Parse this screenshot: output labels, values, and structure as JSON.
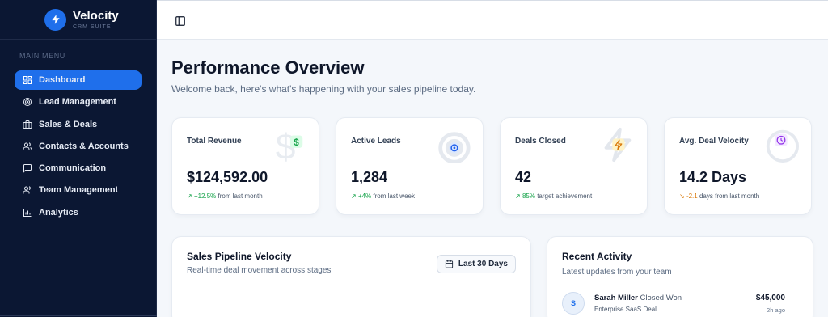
{
  "brand": {
    "name": "Velocity",
    "subtitle": "CRM SUITE"
  },
  "sidebar": {
    "menu_title": "MAIN MENU",
    "items": [
      {
        "label": "Dashboard",
        "icon": "dashboard-icon",
        "active": true
      },
      {
        "label": "Lead Management",
        "icon": "target-icon"
      },
      {
        "label": "Sales & Deals",
        "icon": "briefcase-icon"
      },
      {
        "label": "Contacts & Accounts",
        "icon": "users-icon"
      },
      {
        "label": "Communication",
        "icon": "chat-icon"
      },
      {
        "label": "Team Management",
        "icon": "team-icon"
      },
      {
        "label": "Analytics",
        "icon": "bar-chart-icon"
      }
    ]
  },
  "topbar": {
    "toggle_icon": "panel-toggle-icon"
  },
  "page": {
    "title": "Performance Overview",
    "subtitle": "Welcome back, here's what's happening with your sales pipeline today."
  },
  "stats": [
    {
      "label": "Total Revenue",
      "value": "$124,592.00",
      "delta": "+12.5%",
      "delta_text": "from last month",
      "trend": "up",
      "icon": "dollar-icon",
      "color": "#16a34a"
    },
    {
      "label": "Active Leads",
      "value": "1,284",
      "delta": "+4%",
      "delta_text": "from last week",
      "trend": "up",
      "icon": "target-icon",
      "color": "#2563eb"
    },
    {
      "label": "Deals Closed",
      "value": "42",
      "delta": "85%",
      "delta_text": "target achievement",
      "trend": "up",
      "icon": "lightning-icon",
      "color": "#d97706"
    },
    {
      "label": "Avg. Deal Velocity",
      "value": "14.2 Days",
      "delta": "-2.1",
      "delta_text": "days from last month",
      "trend": "down",
      "icon": "clock-icon",
      "color": "#9333ea"
    }
  ],
  "pipeline": {
    "title": "Sales Pipeline Velocity",
    "subtitle": "Real-time deal movement across stages",
    "range_label": "Last 30 Days"
  },
  "activity": {
    "title": "Recent Activity",
    "subtitle": "Latest updates from your team",
    "items": [
      {
        "initial": "S",
        "name": "Sarah Miller",
        "action": "Closed Won",
        "deal": "Enterprise SaaS Deal",
        "amount": "$45,000",
        "time": "2h ago"
      }
    ]
  }
}
